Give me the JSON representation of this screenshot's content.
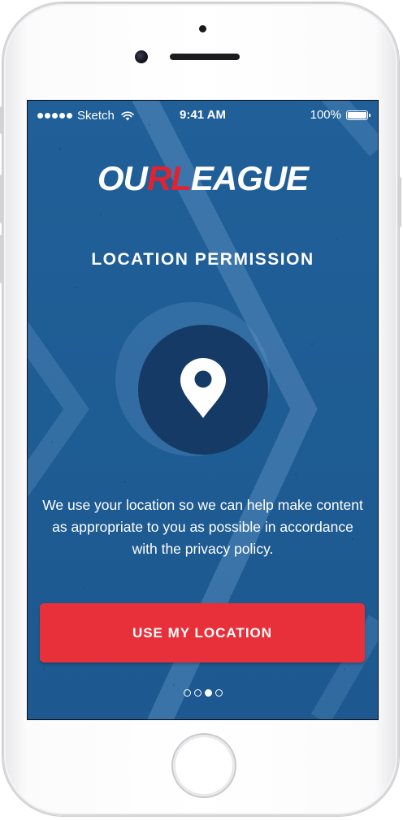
{
  "status_bar": {
    "carrier": "Sketch",
    "time": "9:41 AM",
    "battery": "100%"
  },
  "logo": {
    "part1": "OU",
    "part2": "RL",
    "part3": "EAGUE"
  },
  "screen": {
    "title": "LOCATION PERMISSION",
    "description": "We use your location so we can help make content as appropriate to you as possible in accordance with the privacy policy.",
    "cta_label": "USE MY LOCATION"
  },
  "pagination": {
    "total": 4,
    "active_index": 3
  },
  "icons": {
    "main": "location-pin-icon"
  },
  "colors": {
    "background": "#1f5f96",
    "accent": "#e8303a",
    "logo_accent": "#e3222f",
    "circle": "#163a66"
  }
}
